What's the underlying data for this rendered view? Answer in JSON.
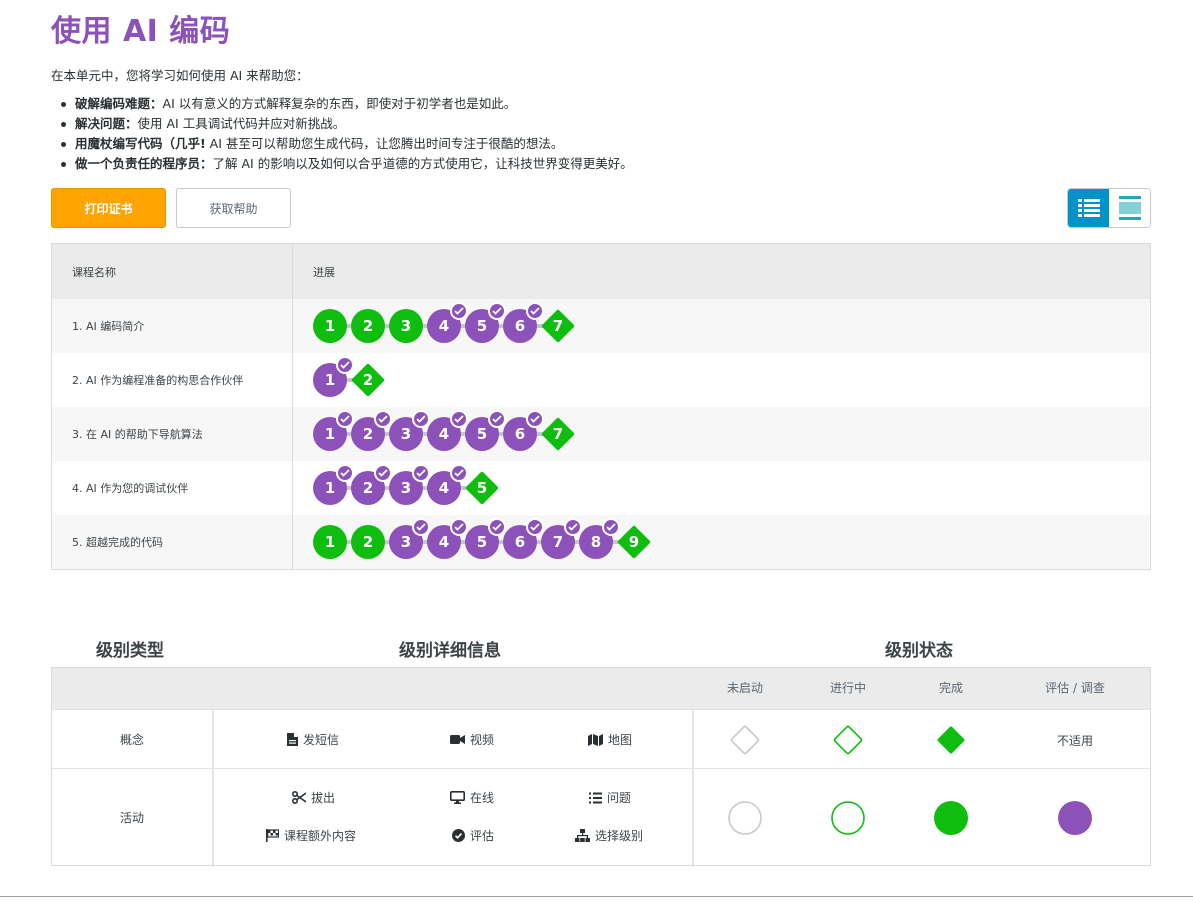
{
  "page": {
    "title": "使用 AI 编码",
    "intro": "在本单元中，您将学习如何使用 AI 来帮助您：",
    "bullets": [
      {
        "bold": "破解编码难题：",
        "text": "AI 以有意义的方式解释复杂的东西，即使对于初学者也是如此。"
      },
      {
        "bold": "解决问题：",
        "text": "使用 AI 工具调试代码并应对新挑战。"
      },
      {
        "bold": "用魔杖编写代码（几乎!",
        "text": " AI 甚至可以帮助您生成代码，让您腾出时间专注于很酷的想法。"
      },
      {
        "bold": "做一个负责任的程序员：",
        "text": "了解 AI 的影响以及如何以合乎道德的方式使用它，让科技世界变得更美好。"
      }
    ]
  },
  "buttons": {
    "print_label": "打印证书",
    "help_label": "获取帮助"
  },
  "view_toggle": {
    "active": "list-view",
    "options": [
      "list-view-icon",
      "summary-view-icon"
    ]
  },
  "progress_table": {
    "headers": {
      "name": "课程名称",
      "progress": "进展"
    },
    "rows": [
      {
        "name": "1. AI 编码简介",
        "levels": [
          {
            "n": "1",
            "kind": "bubble",
            "status": "completed"
          },
          {
            "n": "2",
            "kind": "bubble",
            "status": "completed"
          },
          {
            "n": "3",
            "kind": "bubble",
            "status": "completed"
          },
          {
            "n": "4",
            "kind": "bubble",
            "status": "assessment"
          },
          {
            "n": "5",
            "kind": "bubble",
            "status": "assessment"
          },
          {
            "n": "6",
            "kind": "bubble",
            "status": "assessment"
          },
          {
            "n": "7",
            "kind": "diamond",
            "status": "completed"
          }
        ]
      },
      {
        "name": "2. AI 作为编程准备的构思合作伙伴",
        "levels": [
          {
            "n": "1",
            "kind": "bubble",
            "status": "assessment"
          },
          {
            "n": "2",
            "kind": "diamond",
            "status": "completed"
          }
        ]
      },
      {
        "name": "3. 在 AI 的帮助下导航算法",
        "levels": [
          {
            "n": "1",
            "kind": "bubble",
            "status": "assessment"
          },
          {
            "n": "2",
            "kind": "bubble",
            "status": "assessment"
          },
          {
            "n": "3",
            "kind": "bubble",
            "status": "assessment"
          },
          {
            "n": "4",
            "kind": "bubble",
            "status": "assessment"
          },
          {
            "n": "5",
            "kind": "bubble",
            "status": "assessment"
          },
          {
            "n": "6",
            "kind": "bubble",
            "status": "assessment"
          },
          {
            "n": "7",
            "kind": "diamond",
            "status": "completed"
          }
        ]
      },
      {
        "name": "4. AI 作为您的调试伙伴",
        "levels": [
          {
            "n": "1",
            "kind": "bubble",
            "status": "assessment"
          },
          {
            "n": "2",
            "kind": "bubble",
            "status": "assessment"
          },
          {
            "n": "3",
            "kind": "bubble",
            "status": "assessment"
          },
          {
            "n": "4",
            "kind": "bubble",
            "status": "assessment"
          },
          {
            "n": "5",
            "kind": "diamond",
            "status": "completed"
          }
        ]
      },
      {
        "name": "5. 超越完成的代码",
        "levels": [
          {
            "n": "1",
            "kind": "bubble",
            "status": "completed"
          },
          {
            "n": "2",
            "kind": "bubble",
            "status": "completed"
          },
          {
            "n": "3",
            "kind": "bubble",
            "status": "assessment"
          },
          {
            "n": "4",
            "kind": "bubble",
            "status": "assessment"
          },
          {
            "n": "5",
            "kind": "bubble",
            "status": "assessment"
          },
          {
            "n": "6",
            "kind": "bubble",
            "status": "assessment"
          },
          {
            "n": "7",
            "kind": "bubble",
            "status": "assessment"
          },
          {
            "n": "8",
            "kind": "bubble",
            "status": "assessment"
          },
          {
            "n": "9",
            "kind": "diamond",
            "status": "completed"
          }
        ]
      }
    ]
  },
  "legend": {
    "headings": {
      "type": "级别类型",
      "details": "级别详细信息",
      "status": "级别状态"
    },
    "status_headers": [
      "未启动",
      "进行中",
      "完成",
      "评估 / 调查"
    ],
    "rows": [
      {
        "type": "概念",
        "details": [
          {
            "label": "发短信",
            "icon": "file-icon"
          },
          {
            "label": "视频",
            "icon": "video-icon"
          },
          {
            "label": "地图",
            "icon": "map-icon"
          }
        ],
        "na_text": "不适用"
      },
      {
        "type": "活动",
        "details": [
          {
            "label": "拔出",
            "icon": "scissors-icon"
          },
          {
            "label": "在线",
            "icon": "desktop-icon"
          },
          {
            "label": "问题",
            "icon": "list-icon"
          },
          {
            "label": "课程额外内容",
            "icon": "flag-checkered-icon"
          },
          {
            "label": "评估",
            "icon": "check-circle-icon"
          },
          {
            "label": "选择级别",
            "icon": "sitemap-icon"
          }
        ]
      }
    ]
  },
  "colors": {
    "title": "#8c52ba",
    "completed": "#0fbd0f",
    "assessment": "#8c52ba",
    "print_button": "#ffa400",
    "toggle_active": "#0093c9"
  }
}
